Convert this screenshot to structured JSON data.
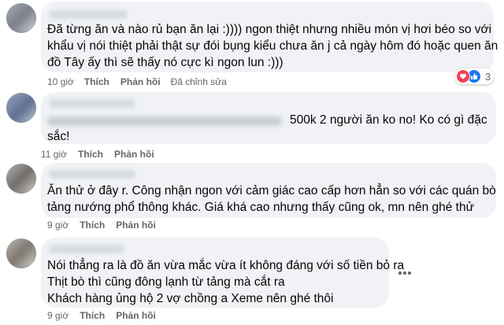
{
  "comments": [
    {
      "text_lines": [
        "Đã từng ăn và nào rủ bạn ăn lại :)))) ngon thiệt nhưng nhiều món vị hơi béo so với",
        "khẩu vị nói thiệt phải thật sự đói bụng kiểu chưa ăn j cả ngày hôm đó hoặc quen ăn",
        "đồ Tây ấy thì sẽ thấy nó cực kì ngon lun :)))"
      ],
      "time": "10 giờ",
      "like_label": "Thích",
      "reply_label": "Phản hồi",
      "edited_label": "Đã chỉnh sửa",
      "reaction_count": "3",
      "reaction_icons": [
        "heart-icon",
        "like-icon"
      ]
    },
    {
      "text_lines": [
        "500k 2 người ăn ko no! Ko có gì đặc",
        "sắc!"
      ],
      "time": "11 giờ",
      "like_label": "Thích",
      "reply_label": "Phản hồi"
    },
    {
      "text_lines": [
        "Ăn thử ở đây r. Công nhận ngon với cảm giác cao cấp hơn hẳn so với các quán bò",
        "tảng nướng phổ thông khác. Giá khá cao nhưng thấy cũng ok, mn nên ghé thử"
      ],
      "time": "9 giờ",
      "like_label": "Thích",
      "reply_label": "Phản hồi"
    },
    {
      "text_lines": [
        "Nói thẳng ra là đồ ăn vừa mắc vừa ít không đáng với số tiền bỏ ra",
        "Thịt bò thì cũng đông lạnh từ tảng mà cắt ra",
        "Khách hàng ủng hộ 2 vợ chồng a Xeme nên ghé thôi"
      ],
      "time": "9 giờ",
      "like_label": "Thích",
      "reply_label": "Phản hồi"
    }
  ],
  "colors": {
    "bubble": "#f0f2f5",
    "meta_text": "#65676b",
    "heart": "#f33e58",
    "like": "#1877f2"
  }
}
